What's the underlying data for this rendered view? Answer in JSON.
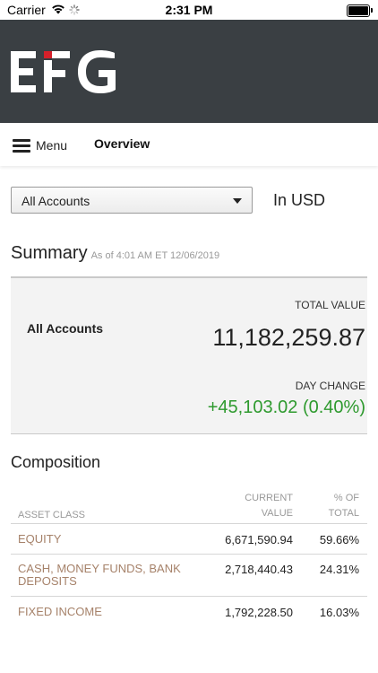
{
  "status_bar": {
    "carrier": "Carrier",
    "time": "2:31 PM",
    "icons": [
      "wifi-icon",
      "activity-spinner-icon",
      "battery-icon"
    ]
  },
  "brand": {
    "logo_text": "EFG",
    "header_color": "#3a3f43",
    "accent_color": "#d4202a"
  },
  "nav": {
    "menu_label": "Menu",
    "active_tab": "Overview"
  },
  "account_select": {
    "selected": "All Accounts"
  },
  "currency_label": "In USD",
  "summary": {
    "title": "Summary",
    "as_of": "As of 4:01 AM ET 12/06/2019",
    "account_name": "All Accounts",
    "total_value_label": "TOTAL VALUE",
    "total_value": "11,182,259.87",
    "day_change_label": "DAY CHANGE",
    "day_change": "+45,103.02 (0.40%)",
    "positive_color": "#2e9a2e"
  },
  "composition": {
    "title": "Composition",
    "headers": {
      "asset_class": "ASSET CLASS",
      "current_value_line1": "CURRENT",
      "current_value_line2": "VALUE",
      "pct_line1": "% OF",
      "pct_line2": "TOTAL"
    },
    "rows": [
      {
        "asset_class": "EQUITY",
        "value": "6,671,590.94",
        "pct": "59.66%"
      },
      {
        "asset_class": "CASH, MONEY FUNDS, BANK DEPOSITS",
        "value": "2,718,440.43",
        "pct": "24.31%"
      },
      {
        "asset_class": "FIXED INCOME",
        "value": "1,792,228.50",
        "pct": "16.03%"
      }
    ],
    "link_color": "#a6826a"
  }
}
